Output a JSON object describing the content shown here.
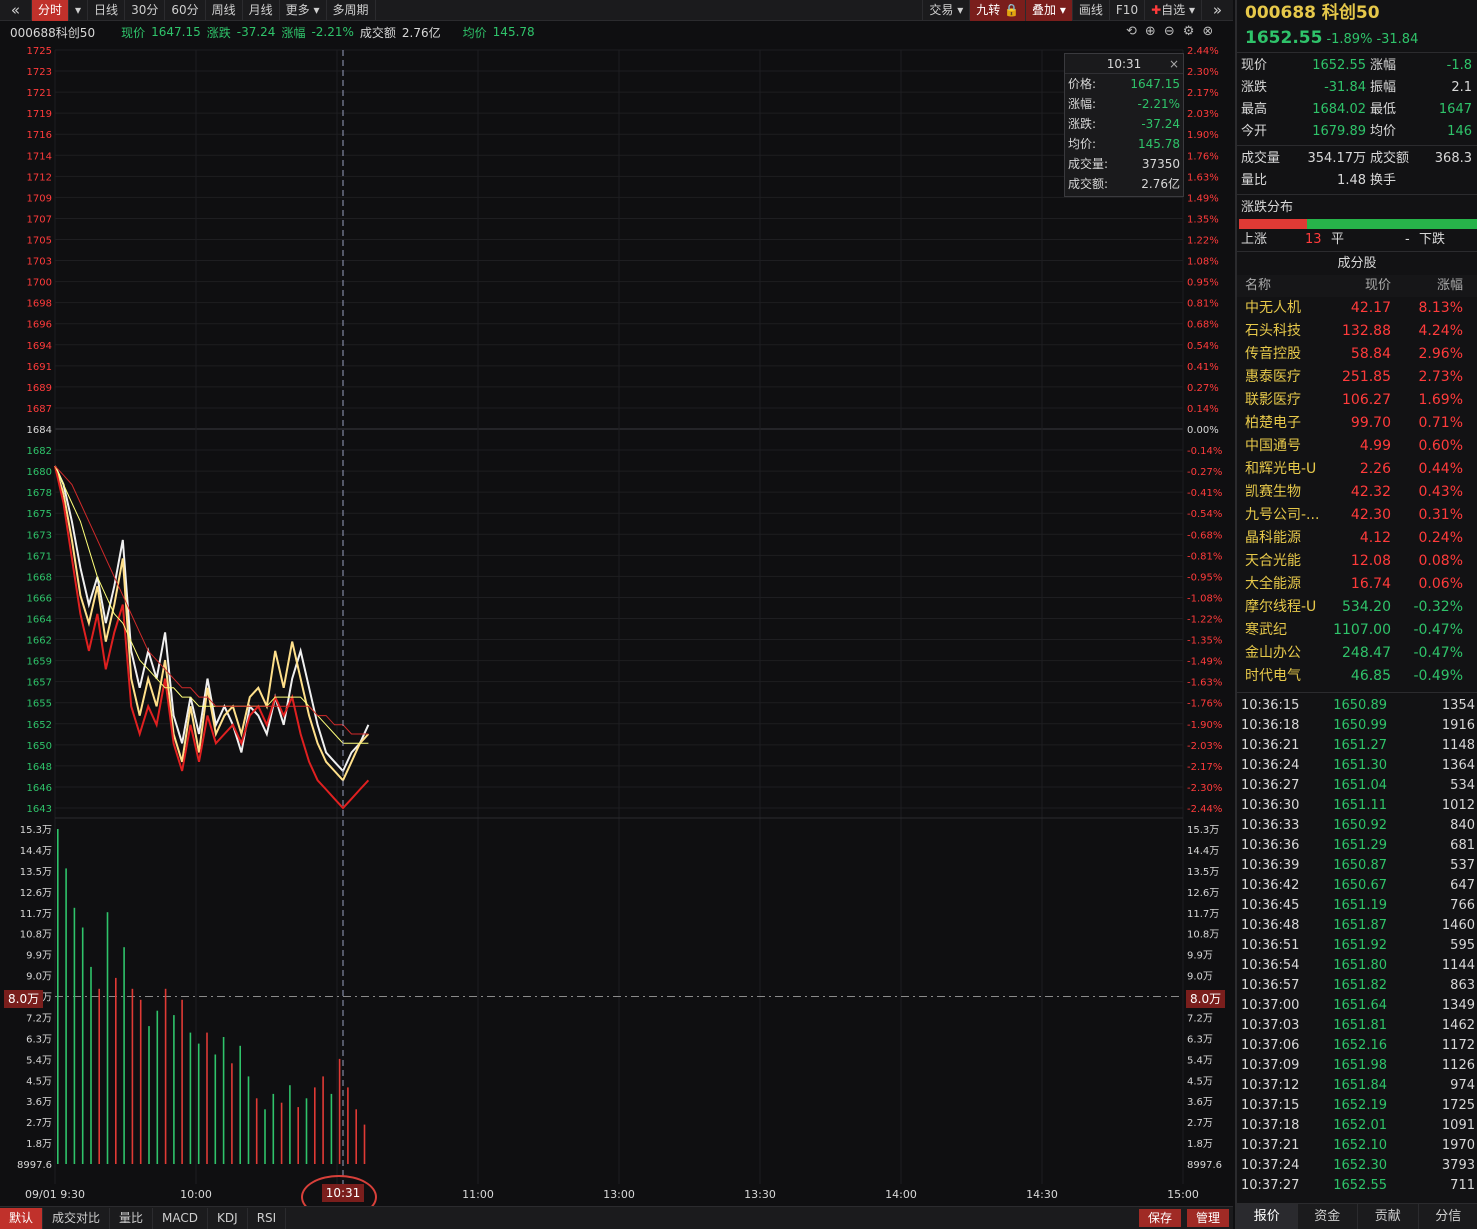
{
  "toolbar": {
    "back": "«",
    "tabs": [
      "分时",
      "日线",
      "30分",
      "60分",
      "周线",
      "月线",
      "更多",
      "多周期"
    ],
    "right": [
      "交易",
      "九转",
      "叠加",
      "画线",
      "F10",
      "自选"
    ],
    "forward": "»"
  },
  "info": {
    "code": "000688科创50",
    "price_label": "现价",
    "price": "1647.15",
    "change_label": "涨跌",
    "change": "-37.24",
    "pct_label": "涨幅",
    "pct": "-2.21%",
    "amount_label": "成交额",
    "amount": "2.76亿",
    "avg_label": "均价",
    "avg": "145.78"
  },
  "tooltip": {
    "time": "10:31",
    "rows": [
      {
        "k": "价格:",
        "v": "1647.15"
      },
      {
        "k": "涨幅:",
        "v": "-2.21%"
      },
      {
        "k": "涨跌:",
        "v": "-37.24"
      },
      {
        "k": "均价:",
        "v": "145.78"
      },
      {
        "k": "成交量:",
        "v": "37350"
      },
      {
        "k": "成交额:",
        "v": "2.76亿"
      }
    ]
  },
  "chart_data": {
    "type": "line",
    "price_axis": [
      "1725",
      "1723",
      "1721",
      "1719",
      "1716",
      "1714",
      "1712",
      "1709",
      "1707",
      "1705",
      "1703",
      "1700",
      "1698",
      "1696",
      "1694",
      "1691",
      "1689",
      "1687",
      "1684",
      "1682",
      "1680",
      "1678",
      "1675",
      "1673",
      "1671",
      "1668",
      "1666",
      "1664",
      "1662",
      "1659",
      "1657",
      "1655",
      "1652",
      "1650",
      "1648",
      "1646",
      "1643"
    ],
    "pct_axis": [
      "2.44%",
      "2.30%",
      "2.17%",
      "2.03%",
      "1.90%",
      "1.76%",
      "1.63%",
      "1.49%",
      "1.35%",
      "1.22%",
      "1.08%",
      "0.95%",
      "0.81%",
      "0.68%",
      "0.54%",
      "0.41%",
      "0.27%",
      "0.14%",
      "0.00%",
      "-0.14%",
      "-0.27%",
      "-0.41%",
      "-0.54%",
      "-0.68%",
      "-0.81%",
      "-0.95%",
      "-1.08%",
      "-1.22%",
      "-1.35%",
      "-1.49%",
      "-1.63%",
      "-1.76%",
      "-1.90%",
      "-2.03%",
      "-2.17%",
      "-2.30%",
      "-2.44%"
    ],
    "vol_axis": [
      "15.3万",
      "14.4万",
      "13.5万",
      "12.6万",
      "11.7万",
      "10.8万",
      "9.9万",
      "9.0万",
      "8.0万",
      "7.2万",
      "6.3万",
      "5.4万",
      "4.5万",
      "3.6万",
      "2.7万",
      "1.8万",
      "8997.6"
    ],
    "time_axis": [
      "09/01 9:30",
      "10:00",
      "10:31",
      "11:00",
      "13:00",
      "13:30",
      "14:00",
      "14:30",
      "15:00"
    ],
    "prev_close": 1684,
    "ylim": [
      1643,
      1725
    ],
    "series": [
      {
        "color": "#f0f0f0",
        "values": [
          1680,
          1678,
          1674,
          1669,
          1665,
          1668,
          1663,
          1667,
          1672,
          1660,
          1656,
          1660,
          1657,
          1662,
          1653,
          1650,
          1655,
          1651,
          1657,
          1652,
          1654,
          1652,
          1649,
          1654,
          1653,
          1651,
          1655,
          1652,
          1657,
          1660,
          1656,
          1652,
          1649,
          1648,
          1647,
          1649,
          1650,
          1652
        ]
      },
      {
        "color": "#ffe08a",
        "values": [
          1680,
          1677,
          1672,
          1666,
          1663,
          1667,
          1661,
          1665,
          1670,
          1657,
          1653,
          1657,
          1654,
          1659,
          1651,
          1648,
          1654,
          1649,
          1656,
          1651,
          1653,
          1654,
          1651,
          1655,
          1656,
          1654,
          1660,
          1656,
          1661,
          1657,
          1653,
          1650,
          1648,
          1647,
          1646,
          1648,
          1650,
          1651
        ]
      },
      {
        "color": "#e02020",
        "values": [
          1680,
          1676,
          1670,
          1664,
          1660,
          1664,
          1658,
          1662,
          1665,
          1654,
          1651,
          1654,
          1652,
          1657,
          1650,
          1647,
          1652,
          1648,
          1653,
          1650,
          1651,
          1652,
          1650,
          1653,
          1654,
          1652,
          1655,
          1653,
          1655,
          1651,
          1648,
          1646,
          1645,
          1644,
          1643,
          1644,
          1645,
          1646
        ]
      },
      {
        "color": "#ffff7a",
        "values": [
          1680,
          1678,
          1676,
          1674,
          1671,
          1668,
          1666,
          1664,
          1663,
          1661,
          1659,
          1658,
          1657,
          1656,
          1656,
          1655,
          1655,
          1654,
          1654,
          1654,
          1654,
          1654,
          1654,
          1654,
          1654,
          1654,
          1655,
          1655,
          1655,
          1655,
          1654,
          1653,
          1652,
          1651,
          1650,
          1650,
          1650,
          1650
        ]
      },
      {
        "color": "#d02a2a",
        "values": [
          1680,
          1679,
          1678,
          1676,
          1674,
          1672,
          1670,
          1668,
          1666,
          1664,
          1662,
          1660,
          1659,
          1658,
          1657,
          1656,
          1656,
          1655,
          1655,
          1654,
          1654,
          1654,
          1654,
          1654,
          1654,
          1654,
          1654,
          1654,
          1654,
          1654,
          1654,
          1653,
          1653,
          1652,
          1652,
          1651,
          1651,
          1651
        ]
      }
    ],
    "volume": [
      {
        "v": 15.3,
        "c": "g"
      },
      {
        "v": 13.5,
        "c": "g"
      },
      {
        "v": 11.7,
        "c": "g"
      },
      {
        "v": 10.8,
        "c": "g"
      },
      {
        "v": 9.0,
        "c": "g"
      },
      {
        "v": 8.0,
        "c": "r"
      },
      {
        "v": 11.5,
        "c": "g"
      },
      {
        "v": 8.5,
        "c": "r"
      },
      {
        "v": 9.9,
        "c": "g"
      },
      {
        "v": 8.0,
        "c": "r"
      },
      {
        "v": 7.5,
        "c": "r"
      },
      {
        "v": 6.3,
        "c": "g"
      },
      {
        "v": 7.0,
        "c": "g"
      },
      {
        "v": 8.0,
        "c": "r"
      },
      {
        "v": 6.8,
        "c": "g"
      },
      {
        "v": 7.5,
        "c": "r"
      },
      {
        "v": 6.0,
        "c": "g"
      },
      {
        "v": 5.5,
        "c": "g"
      },
      {
        "v": 6.0,
        "c": "r"
      },
      {
        "v": 5.0,
        "c": "g"
      },
      {
        "v": 5.8,
        "c": "g"
      },
      {
        "v": 4.6,
        "c": "r"
      },
      {
        "v": 5.4,
        "c": "g"
      },
      {
        "v": 4.0,
        "c": "g"
      },
      {
        "v": 3.0,
        "c": "r"
      },
      {
        "v": 2.5,
        "c": "g"
      },
      {
        "v": 3.2,
        "c": "g"
      },
      {
        "v": 2.8,
        "c": "r"
      },
      {
        "v": 3.6,
        "c": "g"
      },
      {
        "v": 2.6,
        "c": "r"
      },
      {
        "v": 3.0,
        "c": "g"
      },
      {
        "v": 3.5,
        "c": "r"
      },
      {
        "v": 4.0,
        "c": "r"
      },
      {
        "v": 3.2,
        "c": "g"
      },
      {
        "v": 4.8,
        "c": "r"
      },
      {
        "v": 3.5,
        "c": "r"
      },
      {
        "v": 2.5,
        "c": "r"
      },
      {
        "v": 1.8,
        "c": "r"
      }
    ],
    "ref_volume_label": "8.0万"
  },
  "bottom_tabs": [
    "默认",
    "成交对比",
    "量比",
    "MACD",
    "KDJ",
    "RSI"
  ],
  "bottom_right": [
    "保存",
    "管理"
  ],
  "right_panel": {
    "title": "000688 科创50",
    "price": "1652.55",
    "pct": "-1.89%",
    "chg": "-31.84",
    "quote": [
      {
        "k": "现价",
        "v": "1652.55",
        "vc": "g",
        "k2": "涨幅",
        "v2": "-1.8",
        "v2c": "g"
      },
      {
        "k": "涨跌",
        "v": "-31.84",
        "vc": "g",
        "k2": "振幅",
        "v2": "2.1",
        "v2c": "w"
      },
      {
        "k": "最高",
        "v": "1684.02",
        "vc": "g",
        "k2": "最低",
        "v2": "1647",
        "v2c": "g"
      },
      {
        "k": "今开",
        "v": "1679.89",
        "vc": "g",
        "k2": "均价",
        "v2": "146",
        "v2c": "g"
      }
    ],
    "quote2": [
      {
        "k": "成交量",
        "v": "354.17万",
        "vc": "w",
        "k2": "成交额",
        "v2": "368.3",
        "v2c": "w"
      },
      {
        "k": "量比",
        "v": "1.48",
        "vc": "w",
        "k2": "换手",
        "v2": "",
        "v2c": "w"
      }
    ],
    "dist_title": "涨跌分布",
    "dist": {
      "up_label": "上涨",
      "up": "13",
      "flat_label": "平",
      "flat": "-",
      "down_label": "下跌"
    },
    "comp_title": "成分股",
    "comp_head": [
      "名称",
      "现价",
      "涨幅"
    ],
    "components": [
      {
        "name": "中无人机",
        "price": "42.17",
        "pct": "8.13%",
        "c": "r"
      },
      {
        "name": "石头科技",
        "price": "132.88",
        "pct": "4.24%",
        "c": "r"
      },
      {
        "name": "传音控股",
        "price": "58.84",
        "pct": "2.96%",
        "c": "r"
      },
      {
        "name": "惠泰医疗",
        "price": "251.85",
        "pct": "2.73%",
        "c": "r"
      },
      {
        "name": "联影医疗",
        "price": "106.27",
        "pct": "1.69%",
        "c": "r"
      },
      {
        "name": "柏楚电子",
        "price": "99.70",
        "pct": "0.71%",
        "c": "r"
      },
      {
        "name": "中国通号",
        "price": "4.99",
        "pct": "0.60%",
        "c": "r"
      },
      {
        "name": "和辉光电-U",
        "price": "2.26",
        "pct": "0.44%",
        "c": "r"
      },
      {
        "name": "凯赛生物",
        "price": "42.32",
        "pct": "0.43%",
        "c": "r"
      },
      {
        "name": "九号公司-...",
        "price": "42.30",
        "pct": "0.31%",
        "c": "r"
      },
      {
        "name": "晶科能源",
        "price": "4.12",
        "pct": "0.24%",
        "c": "r"
      },
      {
        "name": "天合光能",
        "price": "12.08",
        "pct": "0.08%",
        "c": "r"
      },
      {
        "name": "大全能源",
        "price": "16.74",
        "pct": "0.06%",
        "c": "r"
      },
      {
        "name": "摩尔线程-U",
        "price": "534.20",
        "pct": "-0.32%",
        "c": "g"
      },
      {
        "name": "寒武纪",
        "price": "1107.00",
        "pct": "-0.47%",
        "c": "g"
      },
      {
        "name": "金山办公",
        "price": "248.47",
        "pct": "-0.47%",
        "c": "g"
      },
      {
        "name": "时代电气",
        "price": "46.85",
        "pct": "-0.49%",
        "c": "g"
      }
    ],
    "ticks": [
      [
        "10:36:15",
        "1650.89",
        "1354"
      ],
      [
        "10:36:18",
        "1650.99",
        "1916"
      ],
      [
        "10:36:21",
        "1651.27",
        "1148"
      ],
      [
        "10:36:24",
        "1651.30",
        "1364"
      ],
      [
        "10:36:27",
        "1651.04",
        "534"
      ],
      [
        "10:36:30",
        "1651.11",
        "1012"
      ],
      [
        "10:36:33",
        "1650.92",
        "840"
      ],
      [
        "10:36:36",
        "1651.29",
        "681"
      ],
      [
        "10:36:39",
        "1650.87",
        "537"
      ],
      [
        "10:36:42",
        "1650.67",
        "647"
      ],
      [
        "10:36:45",
        "1651.19",
        "766"
      ],
      [
        "10:36:48",
        "1651.87",
        "1460"
      ],
      [
        "10:36:51",
        "1651.92",
        "595"
      ],
      [
        "10:36:54",
        "1651.80",
        "1144"
      ],
      [
        "10:36:57",
        "1651.82",
        "863"
      ],
      [
        "10:37:00",
        "1651.64",
        "1349"
      ],
      [
        "10:37:03",
        "1651.81",
        "1462"
      ],
      [
        "10:37:06",
        "1652.16",
        "1172"
      ],
      [
        "10:37:09",
        "1651.98",
        "1126"
      ],
      [
        "10:37:12",
        "1651.84",
        "974"
      ],
      [
        "10:37:15",
        "1652.19",
        "1725"
      ],
      [
        "10:37:18",
        "1652.01",
        "1091"
      ],
      [
        "10:37:21",
        "1652.10",
        "1970"
      ],
      [
        "10:37:24",
        "1652.30",
        "3793"
      ],
      [
        "10:37:27",
        "1652.55",
        "711"
      ]
    ],
    "tabs": [
      "报价",
      "资金",
      "贡献",
      "分信"
    ]
  }
}
